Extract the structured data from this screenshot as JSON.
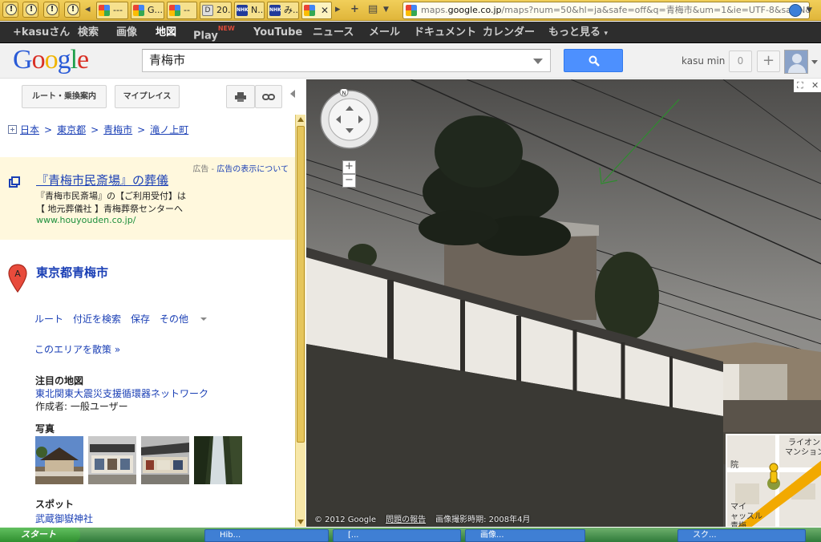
{
  "browser": {
    "warning_tab_glyph": "!",
    "tabs": [
      {
        "label": "---",
        "icon": "google-icon"
      },
      {
        "label": "G...",
        "icon": "google-icon"
      },
      {
        "label": "--",
        "icon": "google-icon"
      },
      {
        "label": "20...",
        "icon": "document-icon"
      },
      {
        "label": "N...",
        "icon": "nhk-icon"
      },
      {
        "label": "み...",
        "icon": "nhk-icon"
      },
      {
        "label": "",
        "icon": "google-icon"
      }
    ],
    "new_tab": "+",
    "url_prefix": "maps.",
    "url_domain": "google.co.jp",
    "url_rest": "/maps?num=50&hl=ja&safe=off&q=青梅市&um=1&ie=UTF-8&sa=N&tab=l"
  },
  "gbar": {
    "items": [
      "+kasuさん",
      "検索",
      "画像",
      "地図",
      "Play",
      "YouTube",
      "ニュース",
      "メール",
      "ドキュメント",
      "カレンダー",
      "もっと見る"
    ],
    "play_badge": "NEW",
    "selected": "地図"
  },
  "header": {
    "logo": [
      "G",
      "o",
      "o",
      "g",
      "l",
      "e"
    ],
    "search_value": "青梅市",
    "user_name": "kasu min",
    "notification_count": "0",
    "share_label": "+"
  },
  "panel": {
    "route_button": "ルート・乗換案内",
    "myplaces_button": "マイプレイス",
    "breadcrumbs": [
      "日本",
      "東京都",
      "青梅市",
      "滝ノ上町"
    ],
    "ad": {
      "label": "広告",
      "about": "広告の表示について",
      "title": "『青梅市民斎場』の葬儀",
      "line1": "『青梅市民斎場』の【ご利用受付】は",
      "line2": "【 地元葬儀社 】青梅葬祭センターへ",
      "url": "www.houyouden.co.jp/"
    },
    "place_marker": "A",
    "place_name": "東京都青梅市",
    "actions": [
      "ルート",
      "付近を検索",
      "保存",
      "その他"
    ],
    "stroll_link": "このエリアを散策 »",
    "featured_title": "注目の地図",
    "featured_map": "東北関東大震災支援循環器ネットワーク",
    "featured_author": "作成者: 一般ユーザー",
    "photos_title": "写真",
    "spots_title": "スポット",
    "spot_1": "武蔵御嶽神社"
  },
  "streetview": {
    "compass": "N",
    "zoom_in": "+",
    "zoom_out": "−",
    "copyright": "© 2012 Google",
    "report": "問題の報告",
    "capture_date": "画像撮影時期: 2008年4月",
    "minimap_labels": [
      "ライオン",
      "マンション",
      "院",
      "マイ",
      "ャッスル",
      "青梅"
    ]
  },
  "colors": {
    "link": "#1a3fb5",
    "search_button": "#4d90fe",
    "ad_background": "#fff8dd",
    "url_green": "#1d8f3c",
    "route_highlight": "#f2a900"
  },
  "taskbar": {
    "start": "スタート",
    "items": [
      "Hib...",
      "[...",
      "画像...",
      "スク..."
    ]
  }
}
